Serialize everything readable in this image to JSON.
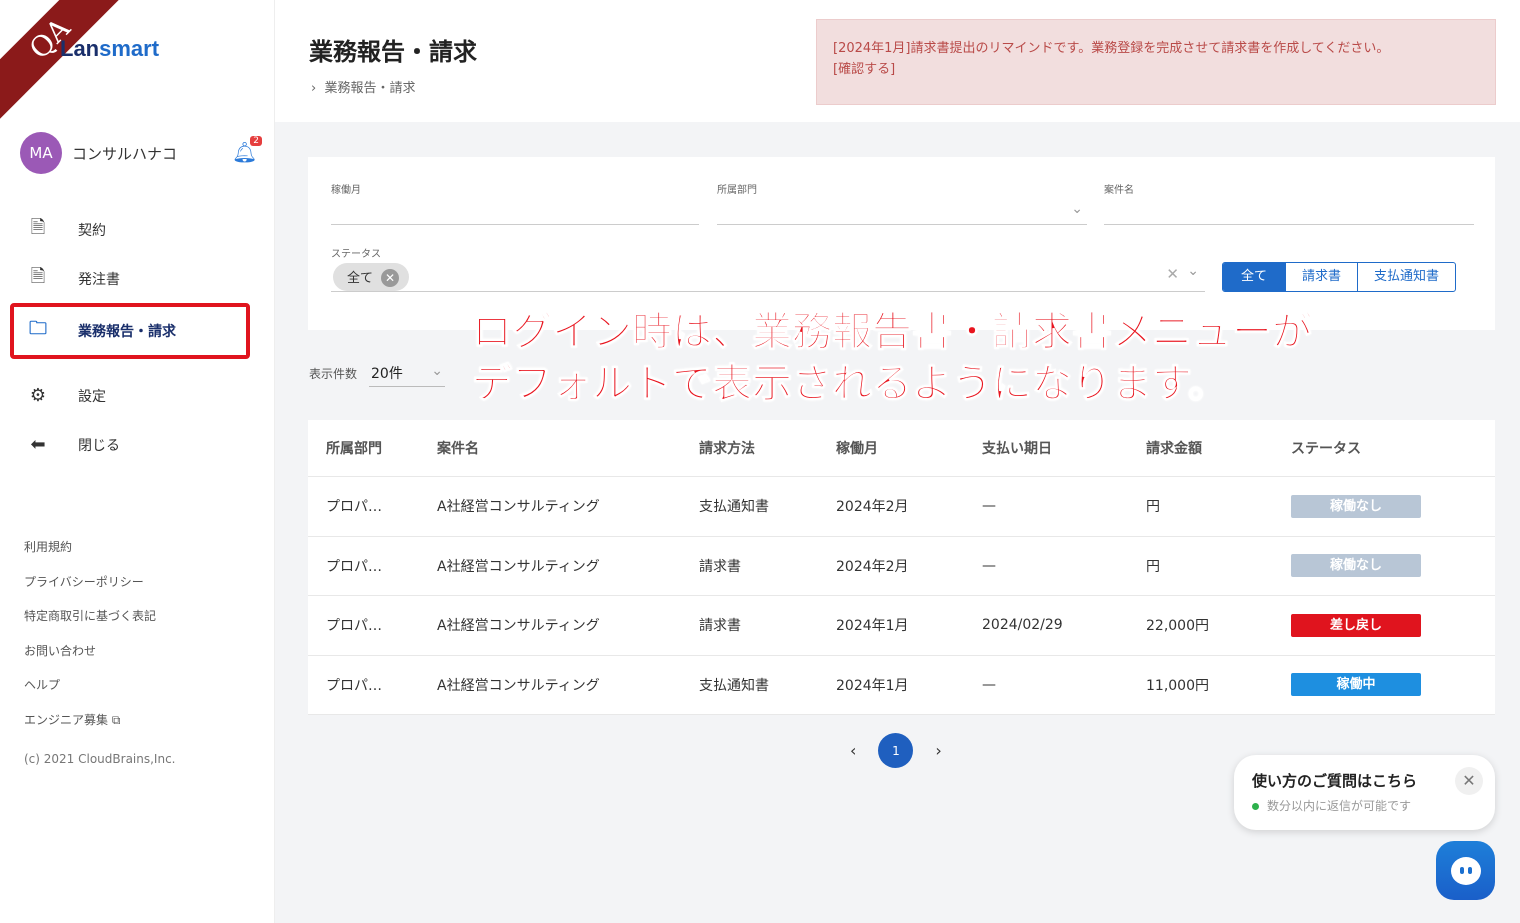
{
  "env_badge": "QA",
  "logo": {
    "part1": "Lan",
    "part2": "smart"
  },
  "user": {
    "initials": "MA",
    "name": "コンサルハナコ",
    "notifications": "2"
  },
  "nav": [
    {
      "label": "契約",
      "icon": "document-icon"
    },
    {
      "label": "発注書",
      "icon": "document-icon"
    },
    {
      "label": "業務報告・請求",
      "icon": "folder-icon",
      "active": true
    },
    {
      "label": "設定",
      "icon": "gear-icon"
    },
    {
      "label": "閉じる",
      "icon": "arrow-left-circle-icon"
    }
  ],
  "footer_links": [
    "利用規約",
    "プライバシーポリシー",
    "特定商取引に基づく表記",
    "お問い合わせ",
    "ヘルプ",
    "エンジニア募集"
  ],
  "copyright": "(c) 2021 CloudBrains,Inc.",
  "header": {
    "title": "業務報告・請求",
    "breadcrumb": "業務報告・請求"
  },
  "alert": {
    "line1": "[2024年1月]請求書提出のリマインドです。業務登録を完成させて請求書を作成してください。",
    "line2": "[確認する]"
  },
  "filters": {
    "month_label": "稼働月",
    "dept_label": "所属部門",
    "project_label": "案件名",
    "status_label": "ステータス",
    "status_chip": "全て",
    "doc_types": [
      "全て",
      "請求書",
      "支払通知書"
    ]
  },
  "page_size": {
    "label": "表示件数",
    "value": "20件"
  },
  "annotation": {
    "line1": "ログイン時は、業務報告書・請求書メニューが",
    "line2": "デフォルトで表示されるようになります。"
  },
  "table": {
    "columns": [
      "所属部門",
      "案件名",
      "請求方法",
      "稼働月",
      "支払い期日",
      "請求金額",
      "ステータス"
    ],
    "rows": [
      [
        "プロパ…",
        "A社経営コンサルティング",
        "支払通知書",
        "2024年2月",
        "—",
        "円",
        "稼働なし"
      ],
      [
        "プロパ…",
        "A社経営コンサルティング",
        "請求書",
        "2024年2月",
        "—",
        "円",
        "稼働なし"
      ],
      [
        "プロパ…",
        "A社経営コンサルティング",
        "請求書",
        "2024年1月",
        "2024/02/29",
        "22,000円",
        "差し戻し"
      ],
      [
        "プロパ…",
        "A社経営コンサルティング",
        "支払通知書",
        "2024年1月",
        "—",
        "11,000円",
        "稼働中"
      ]
    ]
  },
  "status_colors": {
    "稼働なし": "#b8c6d6",
    "差し戻し": "#e0141e",
    "稼働中": "#1e8fe0"
  },
  "pagination": {
    "current": "1"
  },
  "chat": {
    "title": "使い方のご質問はこちら",
    "subtitle": "数分以内に返信が可能です"
  }
}
